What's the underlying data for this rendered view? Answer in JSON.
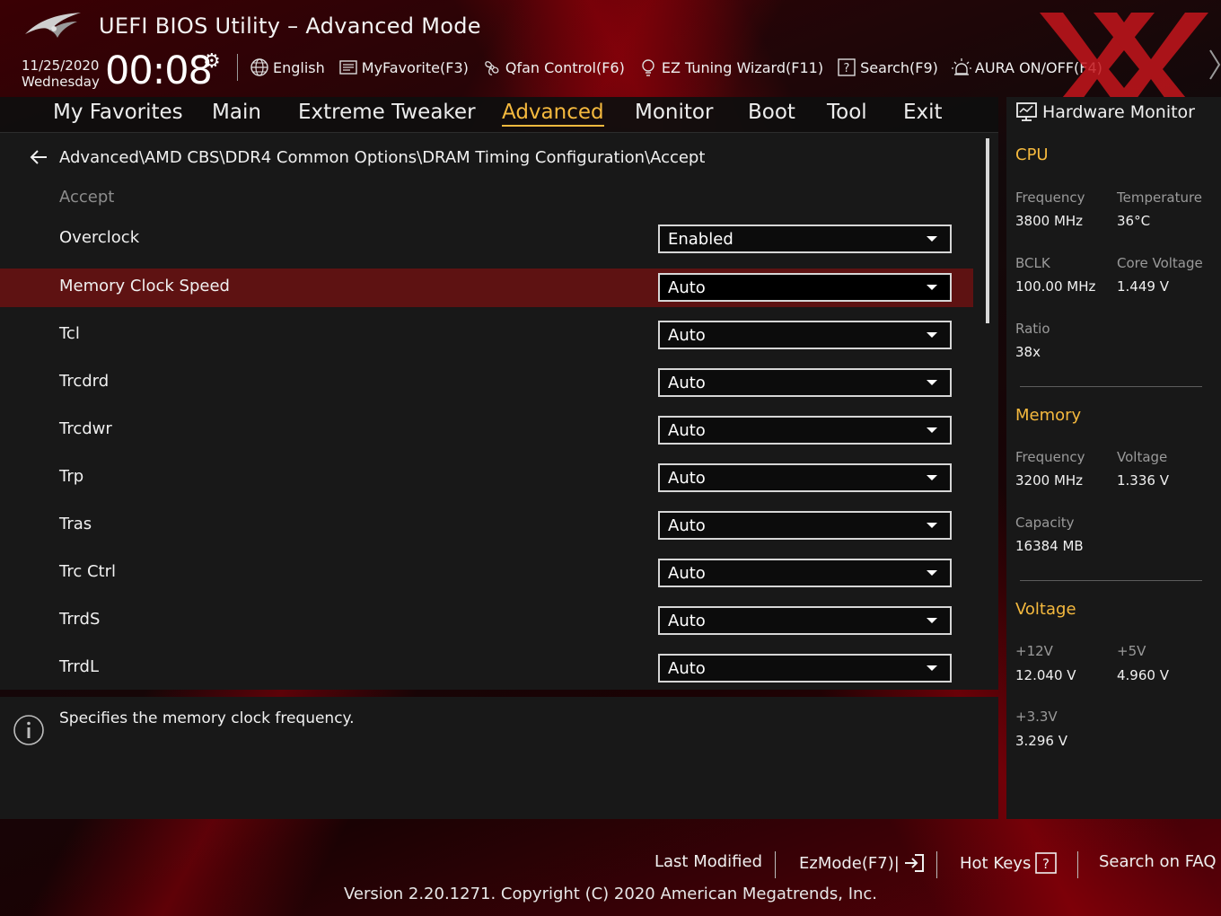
{
  "header": {
    "title": "UEFI BIOS Utility – Advanced Mode",
    "date": "11/25/2020",
    "weekday": "Wednesday",
    "time": "00:08",
    "toolbar": [
      {
        "label": "English",
        "icon": "globe-icon"
      },
      {
        "label": "MyFavorite(F3)",
        "icon": "favorite-list-icon"
      },
      {
        "label": "Qfan Control(F6)",
        "icon": "fan-icon"
      },
      {
        "label": "EZ Tuning Wizard(F11)",
        "icon": "bulb-icon"
      },
      {
        "label": "Search(F9)",
        "icon": "help-box-icon"
      },
      {
        "label": "AURA ON/OFF(F4)",
        "icon": "aura-light-icon"
      }
    ]
  },
  "nav": {
    "tabs": [
      "My Favorites",
      "Main",
      "Extreme Tweaker",
      "Advanced",
      "Monitor",
      "Boot",
      "Tool",
      "Exit"
    ],
    "active": "Advanced"
  },
  "main": {
    "breadcrumb": "Advanced\\AMD CBS\\DDR4 Common Options\\DRAM Timing Configuration\\Accept",
    "section_label": "Accept",
    "settings": [
      {
        "label": "Overclock",
        "value": "Enabled"
      },
      {
        "label": "Memory Clock Speed",
        "value": "Auto"
      },
      {
        "label": "Tcl",
        "value": "Auto"
      },
      {
        "label": "Trcdrd",
        "value": "Auto"
      },
      {
        "label": "Trcdwr",
        "value": "Auto"
      },
      {
        "label": "Trp",
        "value": "Auto"
      },
      {
        "label": "Tras",
        "value": "Auto"
      },
      {
        "label": "Trc Ctrl",
        "value": "Auto"
      },
      {
        "label": "TrrdS",
        "value": "Auto"
      },
      {
        "label": "TrrdL",
        "value": "Auto"
      }
    ],
    "selected_index": 1
  },
  "help": {
    "text": "Specifies the memory clock frequency."
  },
  "hwmon": {
    "title": "Hardware Monitor",
    "cpu": {
      "heading": "CPU",
      "frequency_label": "Frequency",
      "frequency": "3800 MHz",
      "temperature_label": "Temperature",
      "temperature": "36°C",
      "bclk_label": "BCLK",
      "bclk": "100.00 MHz",
      "core_voltage_label": "Core Voltage",
      "core_voltage": "1.449 V",
      "ratio_label": "Ratio",
      "ratio": "38x"
    },
    "memory": {
      "heading": "Memory",
      "frequency_label": "Frequency",
      "frequency": "3200 MHz",
      "voltage_label": "Voltage",
      "voltage": "1.336 V",
      "capacity_label": "Capacity",
      "capacity": "16384 MB"
    },
    "voltage": {
      "heading": "Voltage",
      "v12_label": "+12V",
      "v12": "12.040 V",
      "v5_label": "+5V",
      "v5": "4.960 V",
      "v33_label": "+3.3V",
      "v33": "3.296 V"
    }
  },
  "footer": {
    "last_modified": "Last Modified",
    "ezmode": "EzMode(F7)|",
    "hot_keys": "Hot Keys",
    "search_faq": "Search on FAQ",
    "version": "Version 2.20.1271. Copyright (C) 2020 American Megatrends, Inc."
  },
  "colors": {
    "accent": "#f5b93e",
    "selected_row": "#5e1212",
    "panel": "#181818",
    "brand_red": "#c4161c"
  }
}
